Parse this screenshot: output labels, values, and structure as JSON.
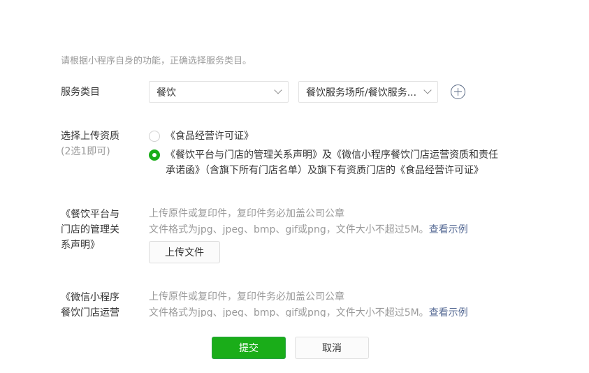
{
  "hint": "请根据小程序自身的功能，正确选择服务类目。",
  "service_category": {
    "label": "服务类目",
    "primary_value": "餐饮",
    "secondary_value": "餐饮服务场所/餐饮服务..."
  },
  "qualification": {
    "label": "选择上传资质",
    "sublabel": "(2选1即可)",
    "options": [
      {
        "text": "《食品经营许可证》",
        "checked": false
      },
      {
        "line1": "《餐饮平台与门店的管理关系声明》及《微信小程序餐饮门店运营资质和责任",
        "line2": "承诺函》（含旗下所有门店名单）及旗下有资质门店的《食品经营许可证》",
        "checked": true
      }
    ]
  },
  "uploads": [
    {
      "label_lines": [
        "《餐饮平台与",
        "门店的管理关",
        "系声明》"
      ],
      "desc1": "上传原件或复印件，复印件务必加盖公司公章",
      "desc2": "文件格式为jpg、jpeg、bmp、gif或png，文件大小不超过5M。",
      "link": "查看示例",
      "button": "上传文件"
    },
    {
      "label_lines": [
        "《微信小程序",
        "餐饮门店运营"
      ],
      "desc1": "上传原件或复印件，复印件务必加盖公司公章",
      "desc2": "文件格式为jpg、jpeg、bmp、gif或png，文件大小不超过5M。",
      "link": "查看示例"
    }
  ],
  "footer": {
    "submit": "提交",
    "cancel": "取消"
  },
  "colors": {
    "primary_green": "#1aad19",
    "link_blue": "#576b95",
    "muted_text": "#9a9a9a"
  }
}
